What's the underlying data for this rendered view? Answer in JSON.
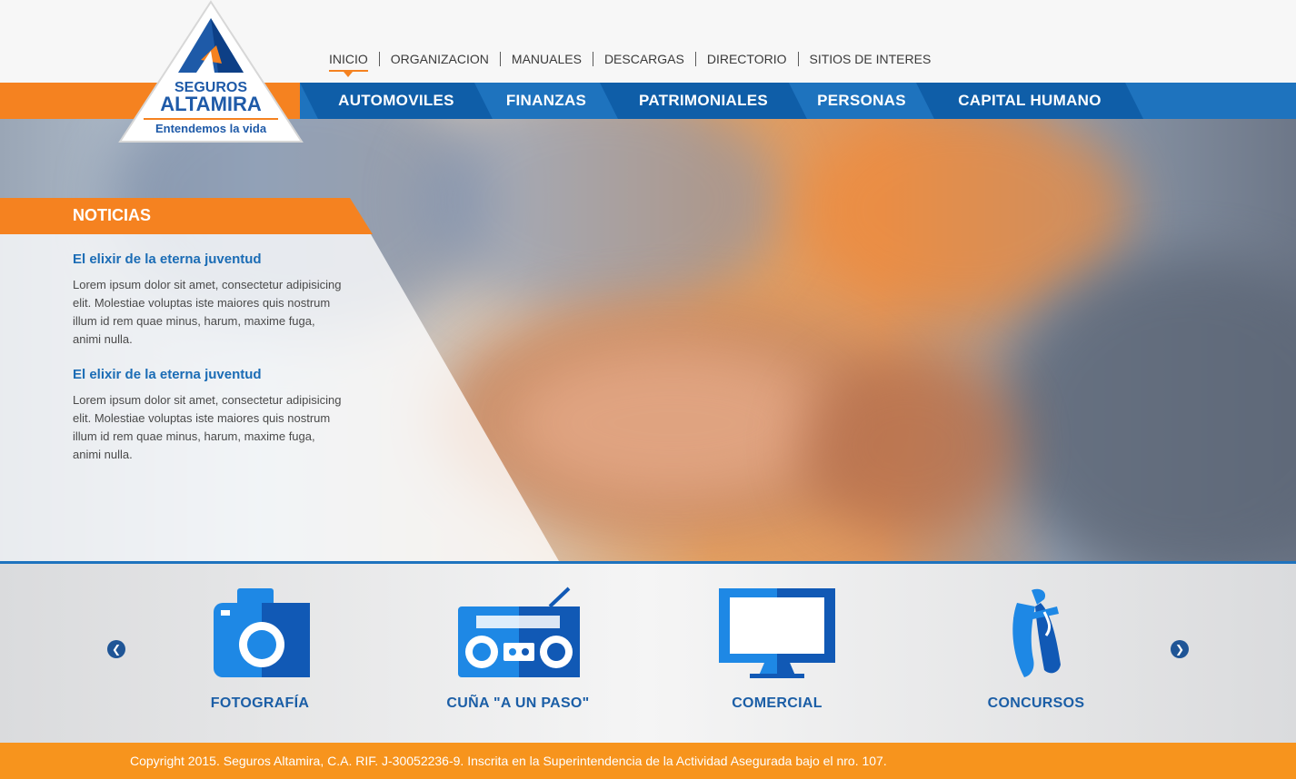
{
  "brand": {
    "name_line1": "SEGUROS",
    "name_line2": "ALTAMIRA",
    "tagline": "Entendemos la vida",
    "colors": {
      "blue": "#1e73be",
      "dark_blue": "#0f5ea8",
      "orange": "#f58220",
      "footer_orange": "#f7941d"
    }
  },
  "top_nav": {
    "items": [
      {
        "label": "INICIO",
        "active": true
      },
      {
        "label": "ORGANIZACION"
      },
      {
        "label": "MANUALES"
      },
      {
        "label": "DESCARGAS"
      },
      {
        "label": "DIRECTORIO"
      },
      {
        "label": "SITIOS DE INTERES"
      }
    ]
  },
  "main_nav": {
    "items": [
      {
        "label": "AUTOMOVILES"
      },
      {
        "label": "FINANZAS"
      },
      {
        "label": "PATRIMONIALES"
      },
      {
        "label": "PERSONAS"
      },
      {
        "label": "CAPITAL HUMANO"
      }
    ]
  },
  "news": {
    "heading": "NOTICIAS",
    "items": [
      {
        "title": "El elixir de la eterna juventud",
        "body": "Lorem ipsum dolor sit amet, consectetur adipisicing elit. Molestiae voluptas iste maiores quis nostrum illum id rem quae minus, harum, maxime fuga, animi nulla."
      },
      {
        "title": "El elixir de la eterna juventud",
        "body": "Lorem ipsum dolor sit amet, consectetur adipisicing elit. Molestiae voluptas iste maiores quis nostrum illum id rem quae minus, harum, maxime fuga, animi nulla."
      }
    ]
  },
  "carousel": {
    "prev_icon": "chevron-left-icon",
    "next_icon": "chevron-right-icon",
    "items": [
      {
        "label": "FOTOGRAFÍA",
        "icon": "camera-icon"
      },
      {
        "label": "CUÑA \"A UN PASO\"",
        "icon": "radio-icon"
      },
      {
        "label": "COMERCIAL",
        "icon": "monitor-icon"
      },
      {
        "label": "CONCURSOS",
        "icon": "ballet-shoes-icon"
      }
    ]
  },
  "footer": {
    "text": "Copyright 2015. Seguros Altamira, C.A. RIF. J-30052236-9. Inscrita en la Superintendencia de la Actividad Asegurada bajo el nro. 107."
  }
}
